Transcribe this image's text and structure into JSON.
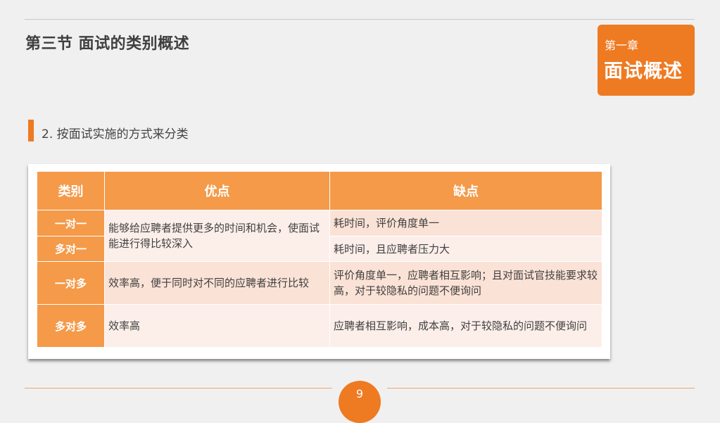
{
  "header": {
    "title": "第三节  面试的类别概述",
    "chapter_label": "第一章",
    "chapter_title": "面试概述"
  },
  "section": {
    "heading": "2. 按面试实施的方式来分类"
  },
  "table": {
    "headers": [
      "类别",
      "优点",
      "缺点"
    ],
    "rows": [
      {
        "category": "一对一",
        "pros": "能够给应聘者提供更多的时间和机会，使面试能进行得比较深入",
        "cons": "耗时间，评价角度单一"
      },
      {
        "category": "多对一",
        "pros": "能够给应聘者提供更多的时间和机会，使面试能进行得比较深入",
        "cons": "耗时间，且应聘者压力大"
      },
      {
        "category": "一对多",
        "pros": "效率高，便于同时对不同的应聘者进行比较",
        "cons": "评价角度单一，应聘者相互影响；且对面试官技能要求较高，对于较隐私的问题不便询问"
      },
      {
        "category": "多对多",
        "pros": "效率高",
        "cons": "应聘者相互影响，成本高，对于较隐私的问题不便询问"
      }
    ]
  },
  "footer": {
    "page_number": "9"
  },
  "colors": {
    "accent": "#ee7a22",
    "table_header": "#f49a49",
    "row_shade_a": "#fbe2d6",
    "row_shade_b": "#fcefea"
  }
}
